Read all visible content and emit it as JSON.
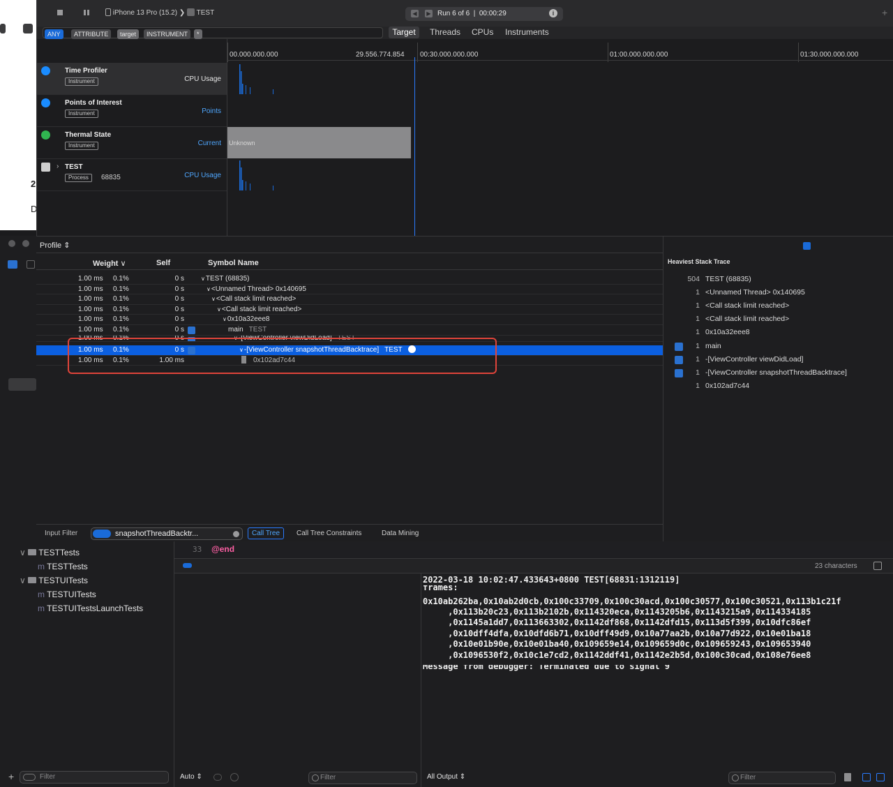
{
  "instruments": {
    "device": "iPhone 13 Pro (15.2)",
    "target": "TEST",
    "run": "Run 6 of 6",
    "elapsed": "00:00:29",
    "filter_tokens": [
      "ANY",
      "ATTRIBUTE",
      "target",
      "INSTRUMENT",
      "*"
    ],
    "segments": [
      "Target",
      "Threads",
      "CPUs",
      "Instruments"
    ],
    "ruler": [
      "00.000.000.000",
      "29.556.774.854",
      "00:30.000.000.000",
      "01:00.000.000.000",
      "01:30.000.000.000"
    ],
    "tracks": [
      {
        "name": "Time Profiler",
        "badge": "Instrument",
        "right": "CPU Usage",
        "icon": "time-profiler-icon",
        "color": "#1a8cff"
      },
      {
        "name": "Points of Interest",
        "badge": "Instrument",
        "right": "Points",
        "icon": "points-of-interest-icon",
        "color": "#1a8cff"
      },
      {
        "name": "Thermal State",
        "badge": "Instrument",
        "right": "Current",
        "icon": "thermal-state-icon",
        "color": "#30b550"
      },
      {
        "name": "TEST",
        "badge": "Process",
        "pid": "68835",
        "right": "CPU Usage",
        "icon": "process-icon",
        "color": "#cfcfcf"
      }
    ],
    "thermal_value": "Unknown"
  },
  "profile": {
    "selector": "Profile",
    "columns": {
      "weight": "Weight",
      "self": "Self",
      "symbol": "Symbol Name"
    },
    "rows": [
      {
        "weight": "1.00 ms",
        "pct": "0.1%",
        "self": "0 s",
        "symbol": "TEST (68835)",
        "lib": ""
      },
      {
        "weight": "1.00 ms",
        "pct": "0.1%",
        "self": "0 s",
        "symbol": "<Unnamed Thread> 0x140695",
        "lib": ""
      },
      {
        "weight": "1.00 ms",
        "pct": "0.1%",
        "self": "0 s",
        "symbol": "<Call stack limit reached>",
        "lib": ""
      },
      {
        "weight": "1.00 ms",
        "pct": "0.1%",
        "self": "0 s",
        "symbol": "<Call stack limit reached>",
        "lib": ""
      },
      {
        "weight": "1.00 ms",
        "pct": "0.1%",
        "self": "0 s",
        "symbol": "0x10a32eee8",
        "lib": ""
      },
      {
        "weight": "1.00 ms",
        "pct": "0.1%",
        "self": "0 s",
        "symbol": "main",
        "lib": "TEST"
      },
      {
        "weight": "1.00 ms",
        "pct": "0.1%",
        "self": "0 s",
        "symbol": "-[ViewController viewDidLoad]",
        "lib": "TEST"
      },
      {
        "weight": "1.00 ms",
        "pct": "0.1%",
        "self": "0 s",
        "symbol": "-[ViewController snapshotThreadBacktrace]",
        "lib": "TEST"
      },
      {
        "weight": "1.00 ms",
        "pct": "0.1%",
        "self": "1.00 ms",
        "symbol": "0x102ad7c44",
        "lib": ""
      }
    ],
    "bottom": {
      "input_filter": "Input Filter",
      "filter_value": "snapshotThreadBacktr...",
      "call_tree": "Call Tree",
      "constraints": "Call Tree Constraints",
      "data_mining": "Data Mining"
    }
  },
  "heaviest": {
    "title": "Heaviest Stack Trace",
    "items": [
      {
        "n": "504",
        "t": "TEST (68835)"
      },
      {
        "n": "1",
        "t": "<Unnamed Thread> 0x140695"
      },
      {
        "n": "1",
        "t": "<Call stack limit reached>"
      },
      {
        "n": "1",
        "t": "<Call stack limit reached>"
      },
      {
        "n": "1",
        "t": "0x10a32eee8"
      },
      {
        "n": "1",
        "t": "main"
      },
      {
        "n": "1",
        "t": "-[ViewController viewDidLoad]"
      },
      {
        "n": "1",
        "t": "-[ViewController snapshotThreadBacktrace]"
      },
      {
        "n": "1",
        "t": "0x102ad7c44"
      }
    ]
  },
  "navigator": {
    "items": [
      "TESTTests",
      "TESTTests",
      "TESTUITests",
      "TESTUITests",
      "TESTUITestsLaunchTests"
    ],
    "filter_placeholder": "Filter"
  },
  "editor": {
    "line_number": "33",
    "code": "@end",
    "char_count": "23 characters"
  },
  "debug": {
    "auto": "Auto",
    "filter": "Filter",
    "output": "All Output",
    "console_filter": "Filter"
  },
  "console": {
    "lines": [
      "2022-03-18 10:02:47.433643+0800 TEST[68831:1312119]",
      "frames:",
      "0x10ab262ba,0x10ab2d0cb,0x100c33709,0x100c30acd,0x100c30577,0x100c30521,0x113b1c21f",
      "     ,0x113b20c23,0x113b2102b,0x114320eca,0x1143205b6,0x1143215a9,0x114334185",
      "     ,0x1145a1dd7,0x113663302,0x1142df868,0x1142dfd15,0x113d5f399,0x10dfc86ef",
      "     ,0x10dff4dfa,0x10dfd6b71,0x10dff49d9,0x10a77aa2b,0x10a77d922,0x10e01ba18",
      "     ,0x10e01b90e,0x10e01ba40,0x109659e14,0x109659d0c,0x109659243,0x109653940",
      "     ,0x1096530f2,0x10c1e7cd2,0x1142ddf41,0x1142e2b5d,0x100c30cad,0x108e76ee8",
      "Message from debugger: Terminated due to signal 9"
    ]
  },
  "colors": {
    "accent": "#0b5fe0",
    "highlight": "#e0443a",
    "link": "#4fa7ff"
  }
}
